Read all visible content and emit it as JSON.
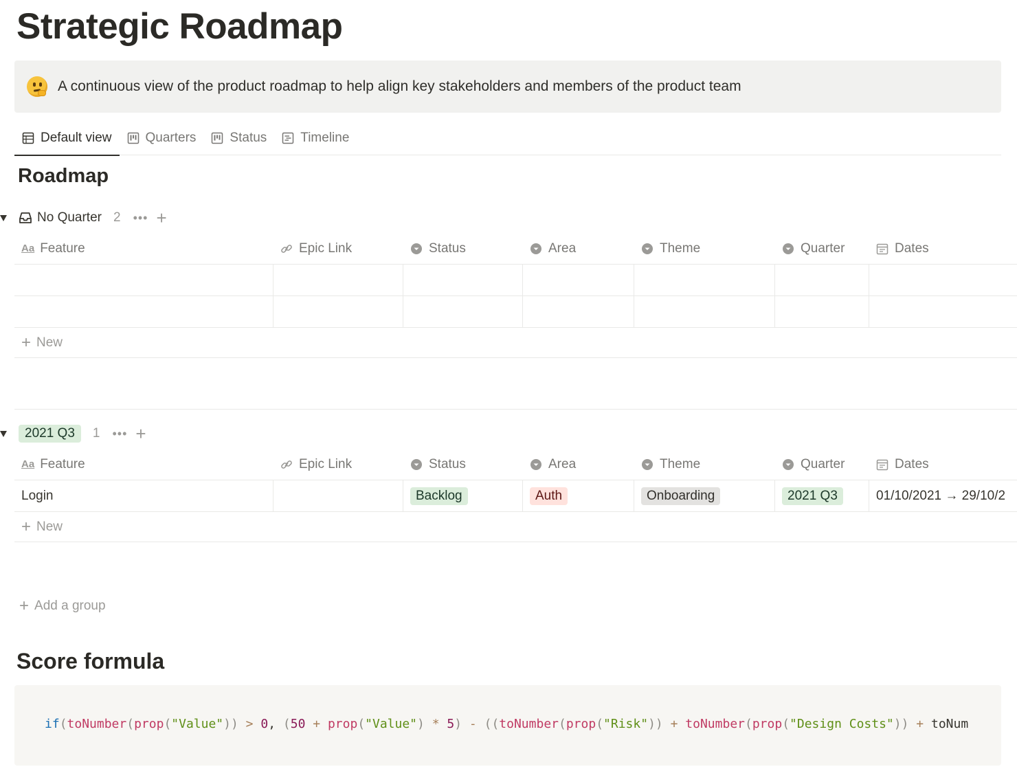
{
  "page": {
    "title": "Strategic Roadmap",
    "callout": {
      "emoji": "thinking-face-emoji",
      "text": "A continuous view of the product roadmap to help align key stakeholders and members of the product team"
    }
  },
  "tabs": [
    {
      "label": "Default view",
      "icon": "table-icon",
      "active": true
    },
    {
      "label": "Quarters",
      "icon": "board-icon",
      "active": false
    },
    {
      "label": "Status",
      "icon": "board-icon",
      "active": false
    },
    {
      "label": "Timeline",
      "icon": "timeline-icon",
      "active": false
    }
  ],
  "database": {
    "title": "Roadmap",
    "columns": [
      {
        "label": "Feature",
        "icon": "title-aa-icon"
      },
      {
        "label": "Epic Link",
        "icon": "relation-icon"
      },
      {
        "label": "Status",
        "icon": "select-icon"
      },
      {
        "label": "Area",
        "icon": "select-icon"
      },
      {
        "label": "Theme",
        "icon": "select-icon"
      },
      {
        "label": "Quarter",
        "icon": "select-icon"
      },
      {
        "label": "Dates",
        "icon": "calendar-icon"
      }
    ],
    "groups": [
      {
        "name": "No Quarter",
        "count": "2",
        "rows": [
          {
            "feature": "",
            "epic_link": "",
            "status": "",
            "area": "",
            "theme": "",
            "quarter": "",
            "dates": ""
          },
          {
            "feature": "",
            "epic_link": "",
            "status": "",
            "area": "",
            "theme": "",
            "quarter": "",
            "dates": ""
          }
        ]
      },
      {
        "name": "2021 Q3",
        "count": "1",
        "rows": [
          {
            "feature": "Login",
            "epic_link": "",
            "status": "Backlog",
            "area": "Auth",
            "theme": "Onboarding",
            "quarter": "2021 Q3",
            "dates": "01/10/2021 → 29/10/2"
          }
        ]
      }
    ],
    "new_label": "New",
    "add_group_label": "Add a group",
    "more_label": "•••",
    "add_symbol": "+"
  },
  "score_formula": {
    "heading": "Score formula",
    "code": "if(toNumber(prop(\"Value\")) > 0, (50 + prop(\"Value\") * 5) - ((toNumber(prop(\"Risk\")) + toNumber(prop(\"Design Costs\")) + toNum"
  },
  "colors": {
    "green_tag": "#dbeddb",
    "red_tag": "#ffe2dd",
    "gray_tag": "#e3e2e0",
    "callout_bg": "#f1f1ef",
    "code_bg": "#f7f6f3"
  }
}
